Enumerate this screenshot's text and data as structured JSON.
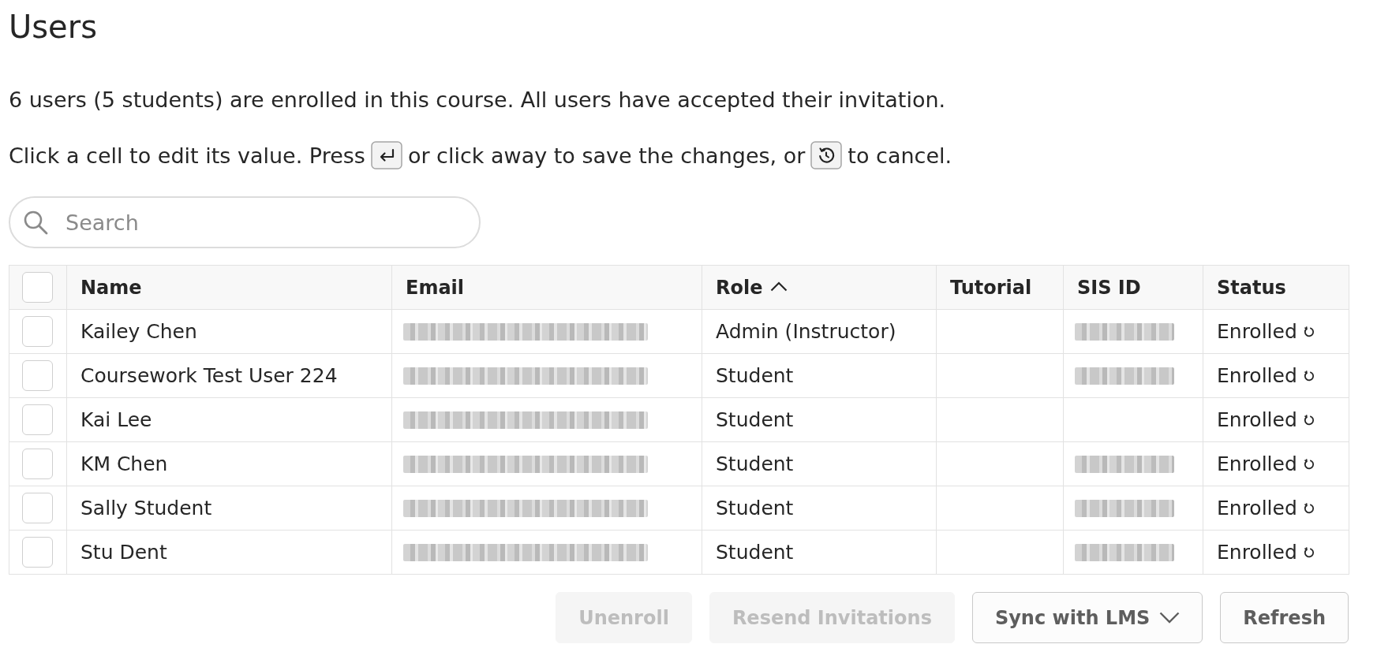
{
  "page": {
    "title": "Users"
  },
  "summary": "6 users (5 students) are enrolled in this course. All users have accepted their invitation.",
  "instruction": [
    {
      "kind": "text",
      "text": "Click a cell to edit its value. Press"
    },
    {
      "kind": "enter_key"
    },
    {
      "kind": "text",
      "text": "or click away to save the changes, or"
    },
    {
      "kind": "undo_key"
    },
    {
      "kind": "text",
      "text": "to cancel."
    }
  ],
  "search": {
    "placeholder": "Search"
  },
  "table": {
    "select_all_checked": false,
    "columns": [
      {
        "label": "Name",
        "sorted": false
      },
      {
        "label": "Email",
        "sorted": false
      },
      {
        "label": "Role",
        "sorted": true
      },
      {
        "label": "Tutorial",
        "sorted": false
      },
      {
        "label": "SIS ID",
        "sorted": false
      },
      {
        "label": "Status",
        "sorted": false
      }
    ],
    "rows": [
      {
        "checked": false,
        "name": "Kailey Chen",
        "email_redacted": true,
        "role": "Admin (Instructor)",
        "sis_id_redacted": true,
        "status": "Enrolled"
      },
      {
        "checked": false,
        "name": "Coursework Test User 224",
        "email_redacted": true,
        "role": "Student",
        "sis_id_redacted": true,
        "status": "Enrolled"
      },
      {
        "checked": false,
        "name": "Kai Lee",
        "email_redacted": true,
        "role": "Student",
        "sis_id_redacted": false,
        "status": "Enrolled"
      },
      {
        "checked": false,
        "name": "KM Chen",
        "email_redacted": true,
        "role": "Student",
        "sis_id_redacted": true,
        "status": "Enrolled"
      },
      {
        "checked": false,
        "name": "Sally Student",
        "email_redacted": true,
        "role": "Student",
        "sis_id_redacted": true,
        "status": "Enrolled"
      },
      {
        "checked": false,
        "name": "Stu Dent",
        "email_redacted": true,
        "role": "Student",
        "sis_id_redacted": true,
        "status": "Enrolled"
      }
    ]
  },
  "buttons": [
    {
      "label": "Unenroll",
      "disabled": true,
      "kind": "plain"
    },
    {
      "label": "Resend Invitations",
      "disabled": true,
      "kind": "plain"
    },
    {
      "label": "Sync with LMS",
      "disabled": false,
      "kind": "dropdown"
    },
    {
      "label": "Refresh",
      "disabled": false,
      "kind": "plain"
    }
  ]
}
